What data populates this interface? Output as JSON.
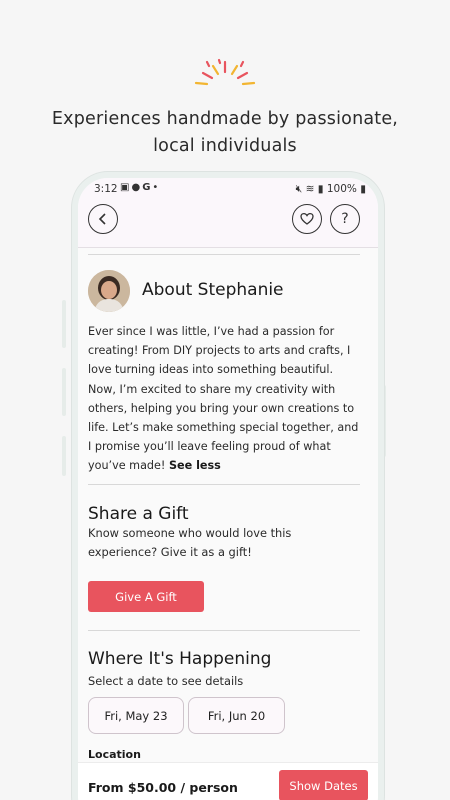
{
  "promo": {
    "headline_line1": "Experiences handmade by passionate,",
    "headline_line2": "local individuals",
    "accent_colors": [
      "#e8545e",
      "#f2b531"
    ]
  },
  "status_bar": {
    "time": "3:12",
    "left_icons": [
      "gallery-icon",
      "facebook-icon",
      "google-icon",
      "dot"
    ],
    "battery": "100%",
    "right_icons": [
      "mute-icon",
      "wifi-icon",
      "signal-icon",
      "battery-icon"
    ]
  },
  "app_bar": {
    "back_icon": "chevron-left-icon",
    "favorite_icon": "heart-icon",
    "help_label": "?"
  },
  "about": {
    "title": "About Stephanie",
    "bio": "Ever since I was little, I’ve had a passion for creating! From DIY projects to arts and crafts, I love turning ideas into something beautiful. Now, I’m excited to share my creativity with others, helping you bring your own creations to life. Let’s make something special together, and I promise you’ll leave feeling proud of what you’ve made!",
    "toggle": "See less"
  },
  "gift": {
    "title": "Share a Gift",
    "subtitle": "Know someone who would love this experience? Give it as a gift!",
    "button": "Give A Gift"
  },
  "location": {
    "title": "Where It's Happening",
    "subtitle": "Select a date to see details",
    "dates": [
      "Fri, May 23",
      "Fri, Jun 20"
    ],
    "label": "Location"
  },
  "footer": {
    "price": "From $50.00 / person",
    "button": "Show Dates"
  },
  "colors": {
    "accent": "#e8545e",
    "app_bar_bg": "#fbf7fb"
  }
}
